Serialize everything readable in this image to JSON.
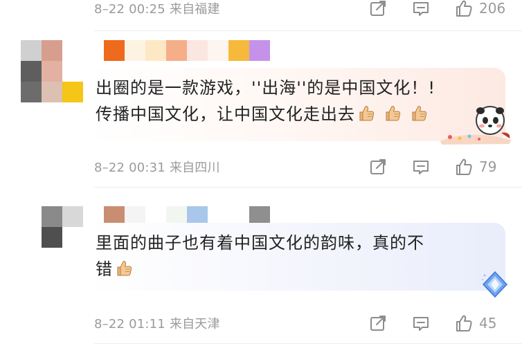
{
  "colors": {
    "meta_text": "#9a9a9a",
    "comment_text": "#222222",
    "bubble_pink": "#fde9e2",
    "bubble_blue": "#e9edfb",
    "divider": "#ededed"
  },
  "comments": [
    {
      "meta": "8–22 00:25  来自福建",
      "likes": "206",
      "icons": [
        "share-icon",
        "reply-icon",
        "like-icon"
      ]
    },
    {
      "text_line_1": "出圈的是一款游戏，''出海''的是中国文化！!",
      "text_line_2": "传播中国文化，让中国文化走出去",
      "emoji": [
        "thumbs-up-icon",
        "thumbs-up-icon",
        "thumbs-up-icon"
      ],
      "sticker": "panda-sticker-icon",
      "meta": "8–22 00:31  来自四川",
      "likes": "79",
      "icons": [
        "share-icon",
        "reply-icon",
        "like-icon"
      ]
    },
    {
      "text_line_1": "里面的曲子也有着中国文化的韵味，真的不",
      "text_line_2": "错",
      "emoji": [
        "thumbs-up-icon"
      ],
      "sticker": "diamond-sticker-icon",
      "meta": "8–22 01:11  来自天津",
      "likes": "45",
      "icons": [
        "share-icon",
        "reply-icon",
        "like-icon"
      ]
    }
  ]
}
